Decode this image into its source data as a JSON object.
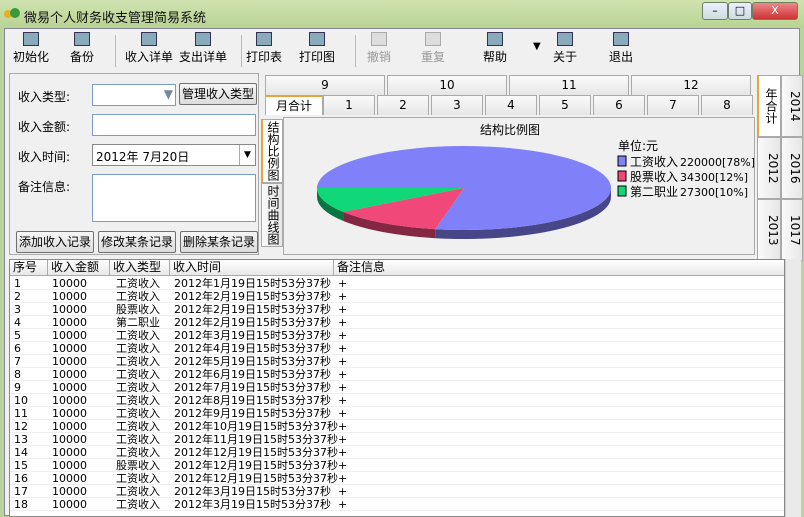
{
  "window": {
    "title": "微易个人财务收支管理简易系统"
  },
  "toolbar": [
    "初始化",
    "备份",
    "收入详单",
    "支出详单",
    "打印表",
    "打印图",
    "撤销",
    "重复",
    "帮助",
    "关于",
    "退出"
  ],
  "form": {
    "type_label": "收入类型:",
    "type_value": "",
    "manage_button": "管理收入类型",
    "amount_label": "收入金额:",
    "amount_value": "",
    "time_label": "收入时间:",
    "time_value": "2012年 7月20日",
    "note_label": "备注信息:",
    "note_value": "",
    "add_button": "添加收入记录",
    "edit_button": "修改某条记录",
    "delete_button": "删除某条记录"
  },
  "month_tabs": {
    "top": [
      "9",
      "10",
      "11",
      "12"
    ],
    "bottom": [
      "月合计",
      "1",
      "2",
      "3",
      "4",
      "5",
      "6",
      "7",
      "8"
    ]
  },
  "side_tabs": [
    "结构比例图",
    "时间曲线图"
  ],
  "year_tabs": {
    "inner": [
      "年合计",
      "2012",
      "2013"
    ],
    "outer": [
      "2014",
      "2016",
      "1017"
    ]
  },
  "chart_data": {
    "type": "pie",
    "title": "结构比例图",
    "unit": "单位:元",
    "slices": [
      {
        "label": "工资收入",
        "value": 220000,
        "pct": "78%",
        "color": "#8080f8"
      },
      {
        "label": "股票收入",
        "value": 34300,
        "pct": "12%",
        "color": "#f04878"
      },
      {
        "label": "第二职业",
        "value": 27300,
        "pct": "10%",
        "color": "#10d878"
      }
    ]
  },
  "table": {
    "headers": [
      "序号",
      "收入金额",
      "收入类型",
      "收入时间",
      "备注信息"
    ],
    "rows": [
      [
        "1",
        "10000",
        "工资收入",
        "2012年1月19日15时53分37秒",
        "+"
      ],
      [
        "2",
        "10000",
        "工资收入",
        "2012年2月19日15时53分37秒",
        "+"
      ],
      [
        "3",
        "10000",
        "股票收入",
        "2012年2月19日15时53分37秒",
        "+"
      ],
      [
        "4",
        "10000",
        "第二职业",
        "2012年2月19日15时53分37秒",
        "+"
      ],
      [
        "5",
        "10000",
        "工资收入",
        "2012年3月19日15时53分37秒",
        "+"
      ],
      [
        "6",
        "10000",
        "工资收入",
        "2012年4月19日15时53分37秒",
        "+"
      ],
      [
        "7",
        "10000",
        "工资收入",
        "2012年5月19日15时53分37秒",
        "+"
      ],
      [
        "8",
        "10000",
        "工资收入",
        "2012年6月19日15时53分37秒",
        "+"
      ],
      [
        "9",
        "10000",
        "工资收入",
        "2012年7月19日15时53分37秒",
        "+"
      ],
      [
        "10",
        "10000",
        "工资收入",
        "2012年8月19日15时53分37秒",
        "+"
      ],
      [
        "11",
        "10000",
        "工资收入",
        "2012年9月19日15时53分37秒",
        "+"
      ],
      [
        "12",
        "10000",
        "工资收入",
        "2012年10月19日15时53分37秒",
        "+"
      ],
      [
        "13",
        "10000",
        "工资收入",
        "2012年11月19日15时53分37秒",
        "+"
      ],
      [
        "14",
        "10000",
        "工资收入",
        "2012年12月19日15时53分37秒",
        "+"
      ],
      [
        "15",
        "10000",
        "股票收入",
        "2012年12月19日15时53分37秒",
        "+"
      ],
      [
        "16",
        "10000",
        "工资收入",
        "2012年12月19日15时53分37秒",
        "+"
      ],
      [
        "17",
        "10000",
        "工资收入",
        "2012年3月19日15时53分37秒",
        "+"
      ],
      [
        "18",
        "10000",
        "工资收入",
        "2012年3月19日15时53分37秒",
        "+"
      ]
    ]
  }
}
